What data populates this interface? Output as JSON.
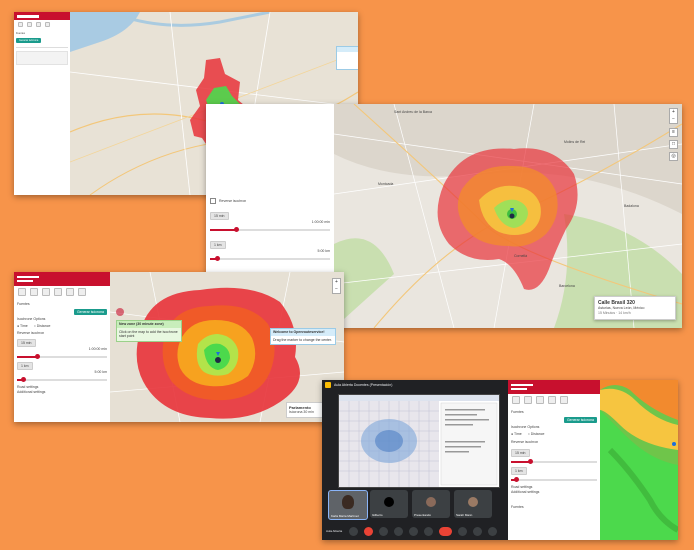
{
  "colors": {
    "background": "#f7944a",
    "brand_red": "#c8102e",
    "accent_green": "#1a9b8c",
    "iso_red": "#e8333a",
    "iso_green": "#4cd94c"
  },
  "shot1": {
    "side_lines": [
      "Fuentes"
    ],
    "button": "Generar isócrona"
  },
  "shot2": {
    "reverse": "Reverse isochron",
    "time_badge": "15 min",
    "time_val": "1:00:00 min",
    "dist_badge": "1 km",
    "dist_val": "5:00 km",
    "places": [
      "Sant Andreu de la Barca",
      "Molins de Rei",
      "Montcada",
      "Cornellà",
      "Badalona",
      "Barcelona"
    ],
    "poi_title": "Calle Brasil 320",
    "poi_sub": "Asturias, Nueva León, México",
    "poi_meta": "15 Minutos · 14 km/h"
  },
  "shot3": {
    "title": "Fuentes",
    "button": "Generar isócrona",
    "options": "Isochrone Options",
    "mode_time": "Time",
    "mode_dist": "Distance",
    "reverse": "Reverse isochron",
    "t_badge": "15 min",
    "t_val": "1:00:00 min",
    "d_badge": "1 km",
    "d_val": "5:00 km",
    "road": "Road settings",
    "add": "Additional settings",
    "popup1_title": "New zone (30 minute zone)",
    "popup1_body": "Click on the map to add the isochrone start point",
    "popup2_title": "Welcome to Openrouteservice!",
    "popup2_body": "Drag the marker to change the center.",
    "poi_title": "Parlamento",
    "poi_sub": "Isócrona 30 min"
  },
  "shot4": {
    "meet_title": "Aula Abierta Docentes (Presentación)",
    "participants": [
      "Karla María Martínez",
      "Gilberto",
      "Presentando",
      "Sarah Mann"
    ],
    "footer_left": "Aula Abierta",
    "title": "Fuentes",
    "button": "Generar isócrona",
    "options": "Isochrone Options",
    "mode_time": "Time",
    "mode_dist": "Distance",
    "reverse": "Reverse isochron",
    "t_badge": "15 min",
    "d_badge": "1 km",
    "road": "Road settings",
    "add": "Additional settings",
    "footer": "Fuentes"
  }
}
